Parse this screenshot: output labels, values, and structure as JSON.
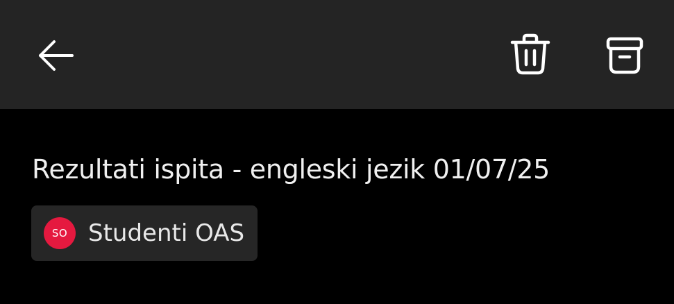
{
  "toolbar": {
    "back_icon": "arrow-left-icon",
    "delete_icon": "trash-icon",
    "archive_icon": "archive-box-icon"
  },
  "message": {
    "subject": "Rezultati ispita - engleski jezik 01/07/25",
    "sender": {
      "initials": "SO",
      "name": "Studenti OAS"
    }
  },
  "colors": {
    "toolbar_bg": "#242424",
    "page_bg": "#000000",
    "avatar_bg": "#e5193f",
    "chip_bg": "#262626"
  }
}
